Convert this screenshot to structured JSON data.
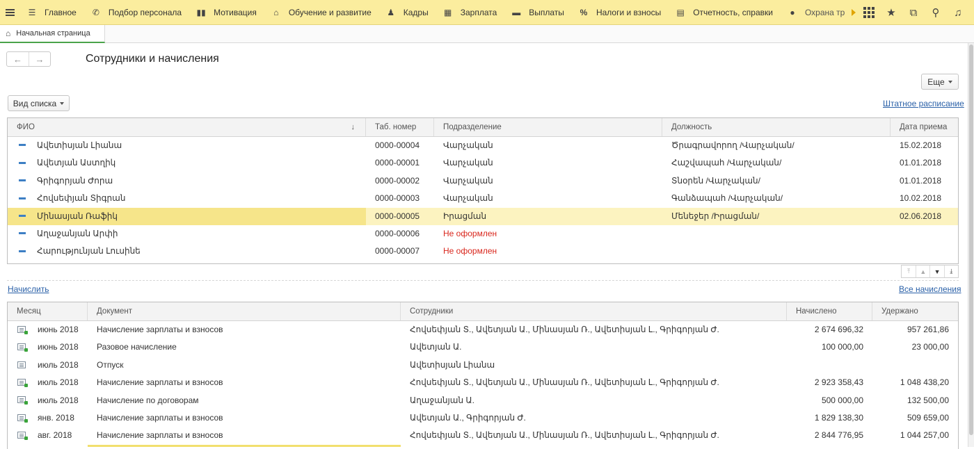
{
  "topbar": {
    "sections": [
      {
        "label": "Главное",
        "icon": "list-icon"
      },
      {
        "label": "Подбор персонала",
        "icon": "handshake-icon"
      },
      {
        "label": "Мотивация",
        "icon": "gift-icon"
      },
      {
        "label": "Обучение и развитие",
        "icon": "graduation-cap-icon"
      },
      {
        "label": "Кадры",
        "icon": "people-icon"
      },
      {
        "label": "Зарплата",
        "icon": "calculator-icon"
      },
      {
        "label": "Выплаты",
        "icon": "wallet-icon"
      },
      {
        "label": "Налоги и взносы",
        "icon": "percent-icon"
      },
      {
        "label": "Отчетность, справки",
        "icon": "report-icon"
      },
      {
        "label": "Охрана тр",
        "icon": "helmet-icon"
      }
    ]
  },
  "tabs": {
    "home_label": "Начальная страница"
  },
  "page": {
    "title": "Сотрудники и начисления"
  },
  "buttons": {
    "more_label": "Еще",
    "view_label": "Вид списка",
    "staffing_link": "Штатное расписание",
    "accrue_link": "Начислить",
    "all_accruals_link": "Все начисления"
  },
  "employees": {
    "columns": [
      "ФИО",
      "Таб. номер",
      "Подразделение",
      "Должность",
      "Дата приема"
    ],
    "rows": [
      {
        "name": "Ավետիսյան Լիանա",
        "tab": "0000-00004",
        "dept": "Վարչական",
        "position": "Ծրագրավորող /Վարչական/",
        "date": "15.02.2018"
      },
      {
        "name": "Ավետյան Աստղիկ",
        "tab": "0000-00001",
        "dept": "Վարչական",
        "position": "Հաշվապահ /Վարչական/",
        "date": "01.01.2018"
      },
      {
        "name": "Գրիգորյան Ժորա",
        "tab": "0000-00002",
        "dept": "Վարչական",
        "position": "Տնօրեն /Վարչական/",
        "date": "01.01.2018"
      },
      {
        "name": "Հովսեփյան Տիգրան",
        "tab": "0000-00003",
        "dept": "Վարչական",
        "position": "Գանձապահ /Վարչական/",
        "date": "10.02.2018"
      },
      {
        "name": "Մինասյան Ռաֆիկ",
        "tab": "0000-00005",
        "dept": "Իրացման",
        "position": "Մենեջեր /Իրացման/",
        "date": "02.06.2018",
        "selected": true
      },
      {
        "name": "Աղաջանյան Արփի",
        "tab": "0000-00006",
        "dept": "Не оформлен",
        "position": "",
        "date": "",
        "unregistered": true
      },
      {
        "name": "Հարությունյան Լուսինե",
        "tab": "0000-00007",
        "dept": "Не оформлен",
        "position": "",
        "date": "",
        "unregistered": true
      }
    ]
  },
  "accruals": {
    "columns": [
      "Месяц",
      "Документ",
      "Сотрудники",
      "Начислено",
      "Удержано"
    ],
    "rows": [
      {
        "month": "июнь 2018",
        "doc": "Начисление зарплаты и взносов",
        "emps": "Հովսեփյան Տ., Ավետյան Ա., Մինասյան Ռ., Ավետիսյան Լ., Գրիգորյան Ժ.",
        "accrued": "2 674 696,32",
        "withheld": "957 261,86",
        "posted": true
      },
      {
        "month": "июнь 2018",
        "doc": "Разовое начисление",
        "emps": "Ավետյան Ա.",
        "accrued": "100 000,00",
        "withheld": "23 000,00",
        "posted": true
      },
      {
        "month": "июль 2018",
        "doc": "Отпуск",
        "emps": "Ավետիսյան Լիանա",
        "accrued": "",
        "withheld": "",
        "posted": false
      },
      {
        "month": "июль 2018",
        "doc": "Начисление зарплаты и взносов",
        "emps": "Հովսեփյան Տ., Ավետյան Ա., Մինասյան Ռ., Ավետիսյան Լ., Գրիգորյան Ժ.",
        "accrued": "2 923 358,43",
        "withheld": "1 048 438,20",
        "posted": true
      },
      {
        "month": "июль 2018",
        "doc": "Начисление по договорам",
        "emps": "Աղաջանյան Ա.",
        "accrued": "500 000,00",
        "withheld": "132 500,00",
        "posted": true
      },
      {
        "month": "янв. 2018",
        "doc": "Начисление зарплаты и взносов",
        "emps": "Ավետյան Ա., Գրիգորյան Ժ.",
        "accrued": "1 829 138,30",
        "withheld": "509 659,00",
        "posted": true
      },
      {
        "month": "авг. 2018",
        "doc": "Начисление зарплаты и взносов",
        "emps": "Հովսեփյան Տ., Ավետյան Ա., Մինասյան Ռ., Ավետիսյան Լ., Գրիգորյան Ժ.",
        "accrued": "2 844 776,95",
        "withheld": "1 044 257,00",
        "posted": true
      }
    ]
  }
}
